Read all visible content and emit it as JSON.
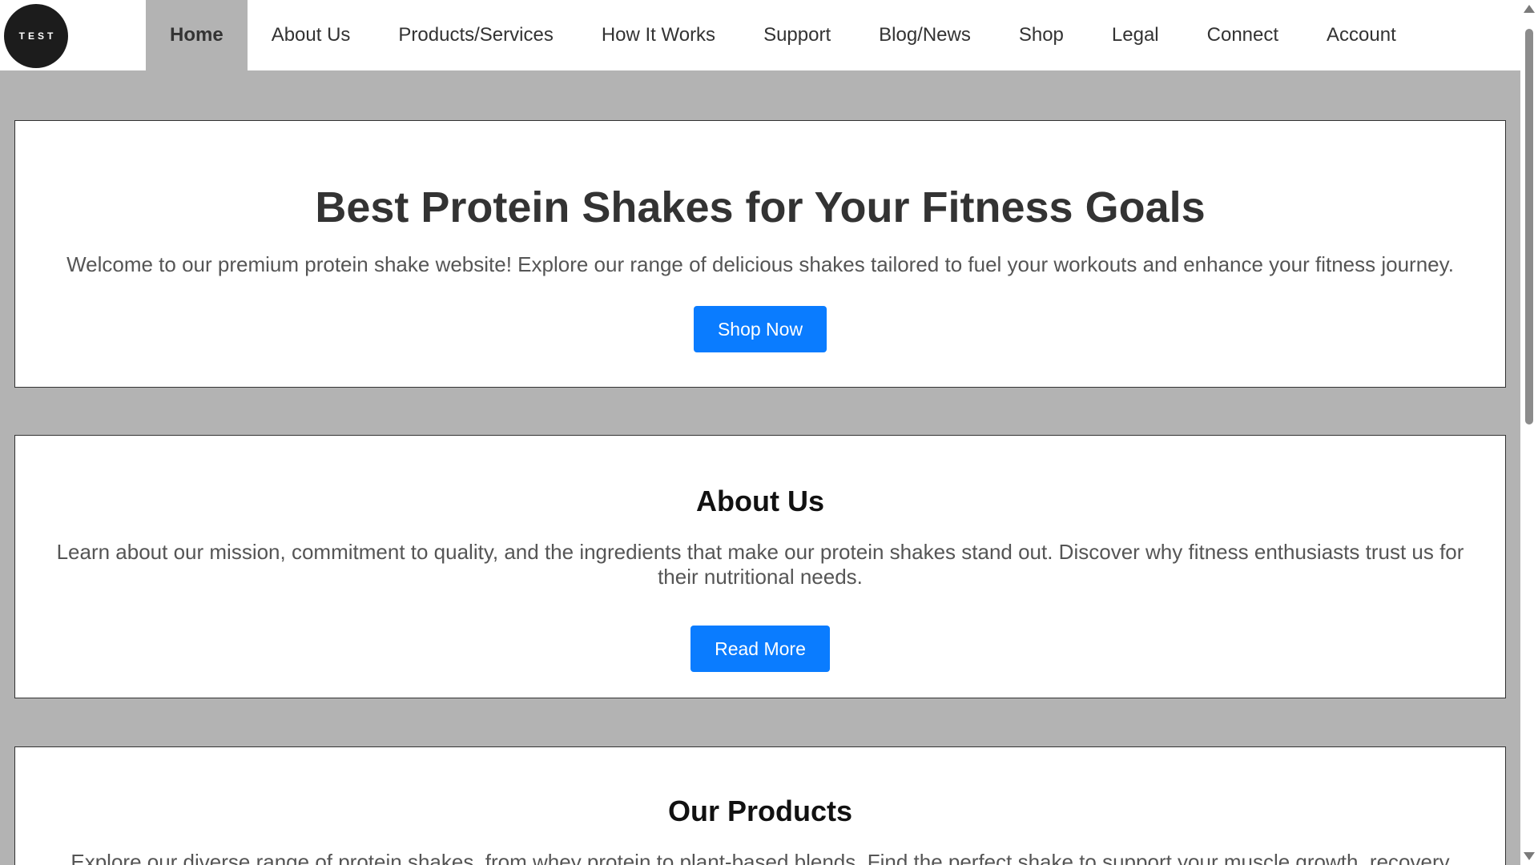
{
  "nav": {
    "logo_text": "TEST",
    "items": [
      {
        "label": "Home",
        "active": true
      },
      {
        "label": "About Us"
      },
      {
        "label": "Products/Services"
      },
      {
        "label": "How It Works"
      },
      {
        "label": "Support"
      },
      {
        "label": "Blog/News"
      },
      {
        "label": "Shop"
      },
      {
        "label": "Legal"
      },
      {
        "label": "Connect"
      },
      {
        "label": "Account"
      }
    ]
  },
  "hero": {
    "title": "Best Protein Shakes for Your Fitness Goals",
    "text": "Welcome to our premium protein shake website! Explore our range of delicious shakes tailored to fuel your workouts and enhance your fitness journey.",
    "button": "Shop Now"
  },
  "about": {
    "title": "About Us",
    "text": "Learn about our mission, commitment to quality, and the ingredients that make our protein shakes stand out. Discover why fitness enthusiasts trust us for their nutritional needs.",
    "button": "Read More"
  },
  "products": {
    "title": "Our Products",
    "text": "Explore our diverse range of protein shakes, from whey protein to plant-based blends. Find the perfect shake to support your muscle growth, recovery"
  },
  "colors": {
    "accent": "#0a7cff",
    "background": "#b3b3b3",
    "nav_background": "#ffffff",
    "logo_background": "#1c1c1c"
  }
}
